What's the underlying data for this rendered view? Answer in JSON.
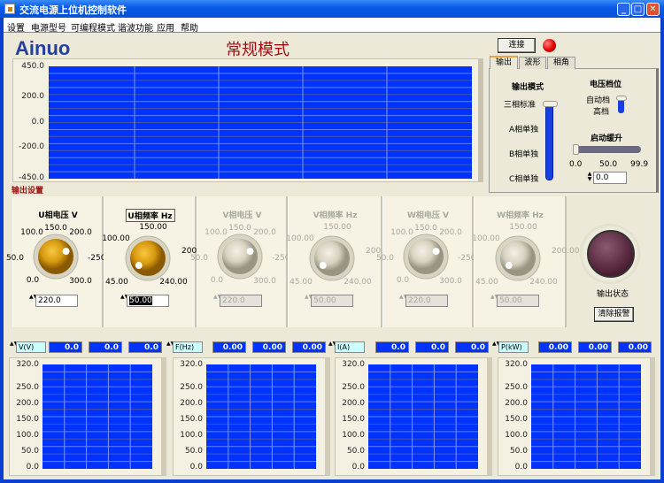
{
  "window": {
    "title": "交流电源上位机控制软件",
    "min": "_",
    "max": "□",
    "close": "✕"
  },
  "menu": [
    "设置",
    "电源型号",
    "可编程模式",
    "谐波功能",
    "应用",
    "帮助"
  ],
  "logo": "Ainuo",
  "mode_title": "常规模式",
  "top_graph": {
    "y_ticks": [
      "450.0",
      "200.0",
      "0.0",
      "-200.0",
      "-450.0"
    ],
    "plot_color": "#0033ff"
  },
  "connect": {
    "label": "连接",
    "led_color": "#e00000"
  },
  "tabs": [
    {
      "label": "输出",
      "active": true
    },
    {
      "label": "波形"
    },
    {
      "label": "相角"
    }
  ],
  "output_tab": {
    "mode_label": "输出模式",
    "mode_options": [
      "三相标准",
      "A相单独",
      "B相单独",
      "C相单独"
    ],
    "mode_selected": "三相标准",
    "range_label": "电压档位",
    "range_options": [
      "自动档",
      "高档"
    ],
    "range_selected": "高档",
    "ramp_label": "启动缓升",
    "ramp_ticks": [
      "0.0",
      "50.0",
      "99.9"
    ],
    "ramp_value": "0.0"
  },
  "output_settings_label": "输出设置",
  "knobs": [
    {
      "title": "U相电压  V",
      "type": "voltage",
      "value": 220.0,
      "display": "220.0",
      "enabled": true,
      "min": 0,
      "max": 300
    },
    {
      "title": "U相频率  Hz",
      "type": "freq",
      "value": 50.0,
      "display": "50.00",
      "enabled": true,
      "focused": true,
      "min": 45,
      "max": 240
    },
    {
      "title": "V相电压  V",
      "type": "voltage",
      "value": 220.0,
      "display": "220.0",
      "enabled": false,
      "min": 0,
      "max": 300
    },
    {
      "title": "V相频率  Hz",
      "type": "freq",
      "value": 50.0,
      "display": "50.00",
      "enabled": false,
      "min": 45,
      "max": 240
    },
    {
      "title": "W相电压  V",
      "type": "voltage",
      "value": 220.0,
      "display": "220.0",
      "enabled": false,
      "min": 0,
      "max": 300
    },
    {
      "title": "W相频率  Hz",
      "type": "freq",
      "value": 50.0,
      "display": "50.00",
      "enabled": false,
      "min": 45,
      "max": 240
    }
  ],
  "voltage_ticks": [
    "0.0",
    "50.0",
    "100.0",
    "150.0",
    "200.0",
    "-250.0",
    "300.0"
  ],
  "freq_ticks": [
    "45.00",
    "100.00",
    "150.00",
    "200.00",
    "240.00"
  ],
  "output_status": {
    "label": "输出状态",
    "led_color": "#5a2a40"
  },
  "clear_alarm": "清除报警",
  "measurements": [
    {
      "label": "V(V)",
      "values": [
        "0.0",
        "0.0",
        "0.0"
      ]
    },
    {
      "label": "F(Hz)",
      "values": [
        "0.00",
        "0.00",
        "0.00"
      ]
    },
    {
      "label": "I(A)",
      "values": [
        "0.0",
        "0.0",
        "0.0"
      ]
    },
    {
      "label": "P(kW)",
      "values": [
        "0.00",
        "0.00",
        "0.00"
      ]
    }
  ],
  "mini_chart_y_ticks": [
    "320.0",
    "250.0",
    "200.0",
    "150.0",
    "100.0",
    "50.0",
    "0.0"
  ]
}
